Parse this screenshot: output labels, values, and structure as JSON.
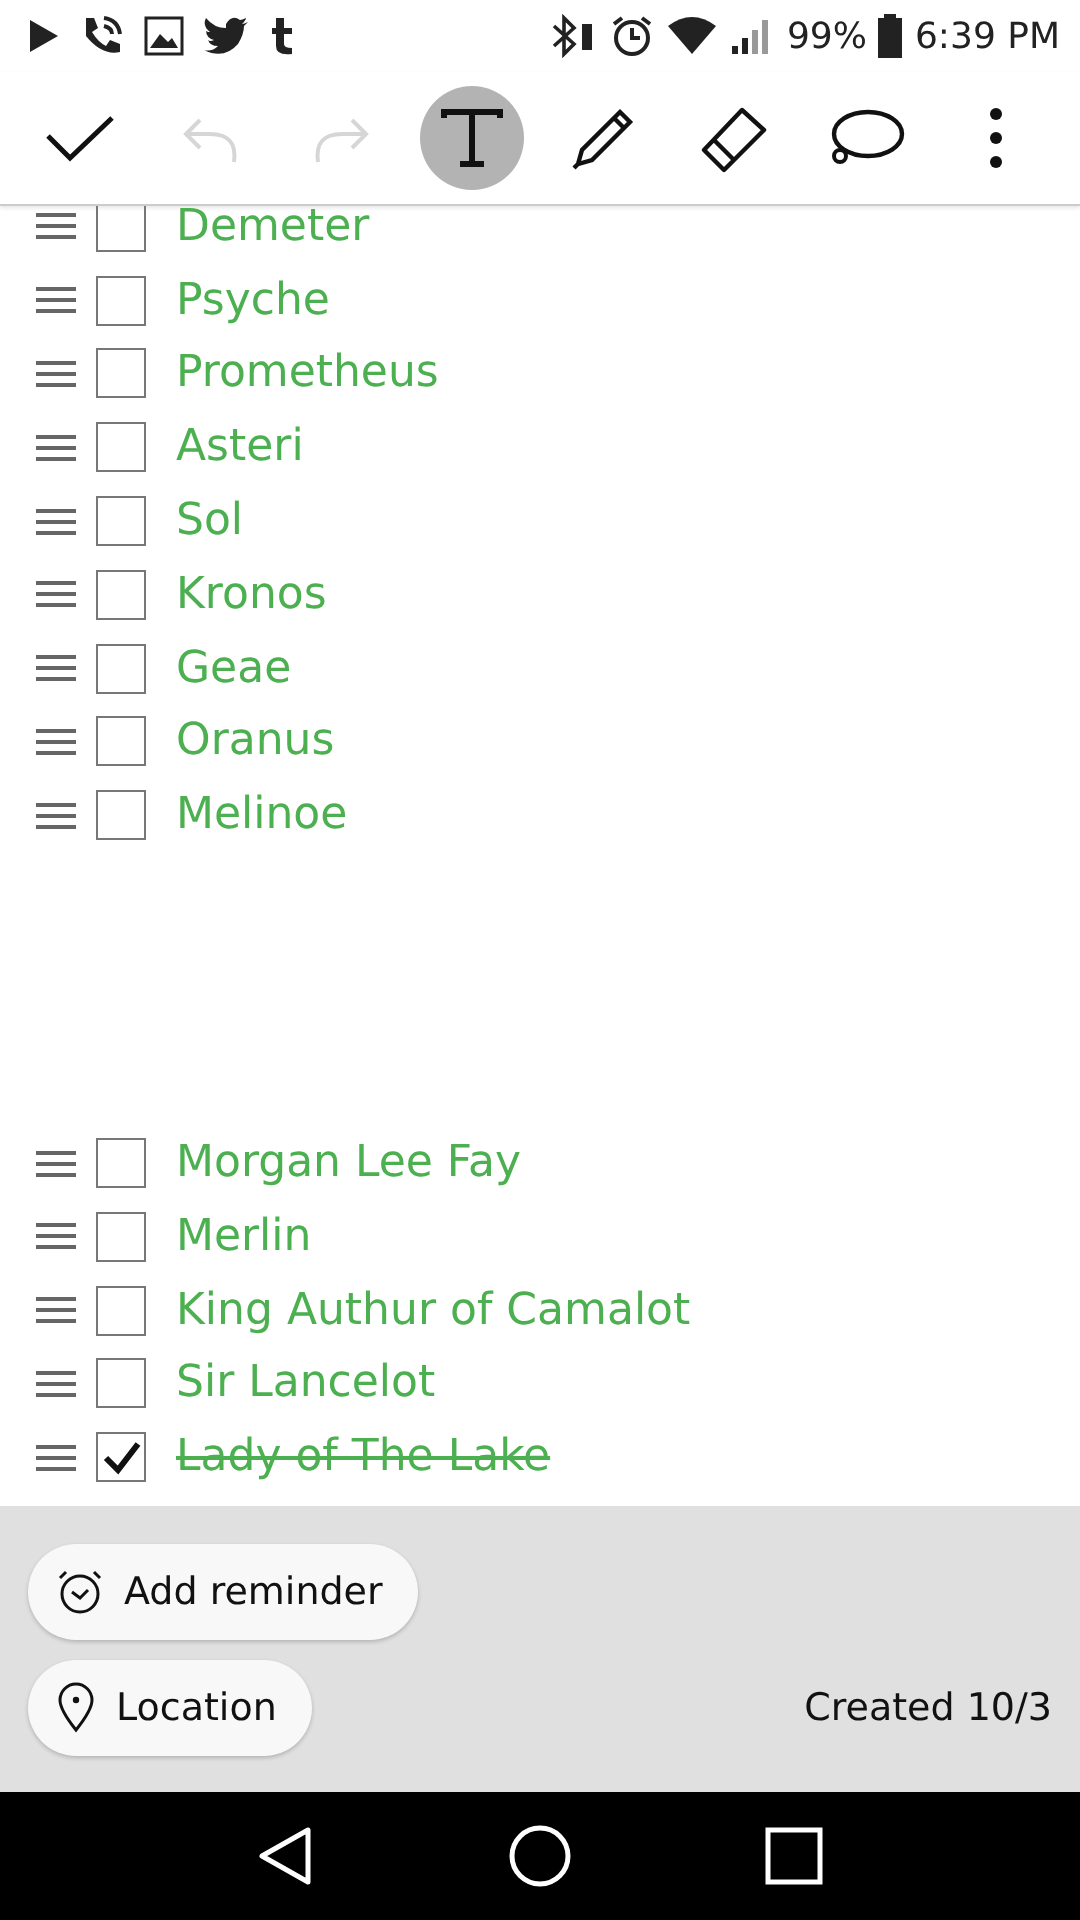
{
  "status_bar": {
    "battery": "99%",
    "time": "6:39 PM"
  },
  "toolbar": [
    {
      "kind": "done",
      "disabled": false,
      "selected": false
    },
    {
      "kind": "undo",
      "disabled": true,
      "selected": false
    },
    {
      "kind": "redo",
      "disabled": true,
      "selected": false
    },
    {
      "kind": "text",
      "disabled": false,
      "selected": true
    },
    {
      "kind": "pen",
      "disabled": false,
      "selected": false
    },
    {
      "kind": "eraser",
      "disabled": false,
      "selected": false
    },
    {
      "kind": "comment",
      "disabled": false,
      "selected": false
    },
    {
      "kind": "more",
      "disabled": false,
      "selected": false
    }
  ],
  "groups": [
    {
      "items": [
        {
          "text": "Demeter",
          "checked": false
        },
        {
          "text": "Psyche",
          "checked": false
        },
        {
          "text": "Prometheus",
          "checked": false
        },
        {
          "text": "Asteri",
          "checked": false
        },
        {
          "text": "Sol",
          "checked": false
        },
        {
          "text": "Kronos",
          "checked": false
        },
        {
          "text": "Geae",
          "checked": false
        },
        {
          "text": "Oranus",
          "checked": false
        },
        {
          "text": "Melinoe",
          "checked": false
        }
      ]
    },
    {
      "items": [
        {
          "text": "Morgan Lee Fay",
          "checked": false
        },
        {
          "text": "Merlin",
          "checked": false
        },
        {
          "text": "King Authur of Camalot",
          "checked": false
        },
        {
          "text": "Sir Lancelot",
          "checked": false
        },
        {
          "text": "Lady of The Lake",
          "checked": true
        }
      ]
    }
  ],
  "footer": {
    "reminder_button": "Add reminder",
    "location_button": "Location",
    "created": "Created 10/3"
  }
}
